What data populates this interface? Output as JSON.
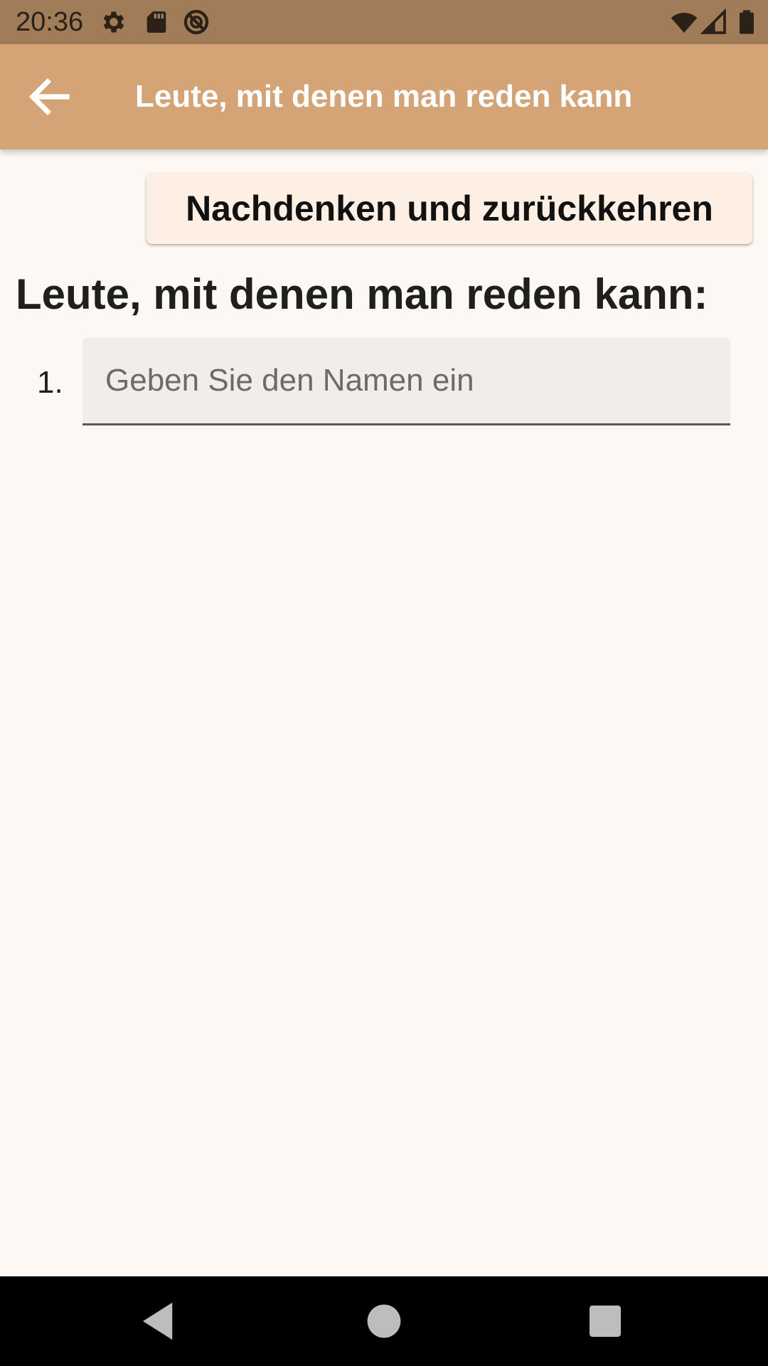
{
  "status_bar": {
    "time": "20:36",
    "icons": [
      "gear-icon",
      "sd-card-icon",
      "do-not-disturb-icon",
      "wifi-icon",
      "signal-icon",
      "battery-icon"
    ]
  },
  "app_bar": {
    "title": "Leute, mit denen man reden kann",
    "back_icon": "arrow-back-icon"
  },
  "main": {
    "action_button_label": "Nachdenken und zurückkehren",
    "heading": "Leute, mit denen man reden kann:",
    "list": [
      {
        "number": "1.",
        "value": "",
        "placeholder": "Geben Sie den Namen ein"
      }
    ]
  },
  "nav_bar": {
    "icons": [
      "back-triangle-icon",
      "home-circle-icon",
      "recents-square-icon"
    ]
  },
  "colors": {
    "status_bar": "#a07c58",
    "app_bar": "#d4a477",
    "background": "#fdf8f3",
    "button": "#fdefe3",
    "input_fill": "#f2ede8"
  }
}
